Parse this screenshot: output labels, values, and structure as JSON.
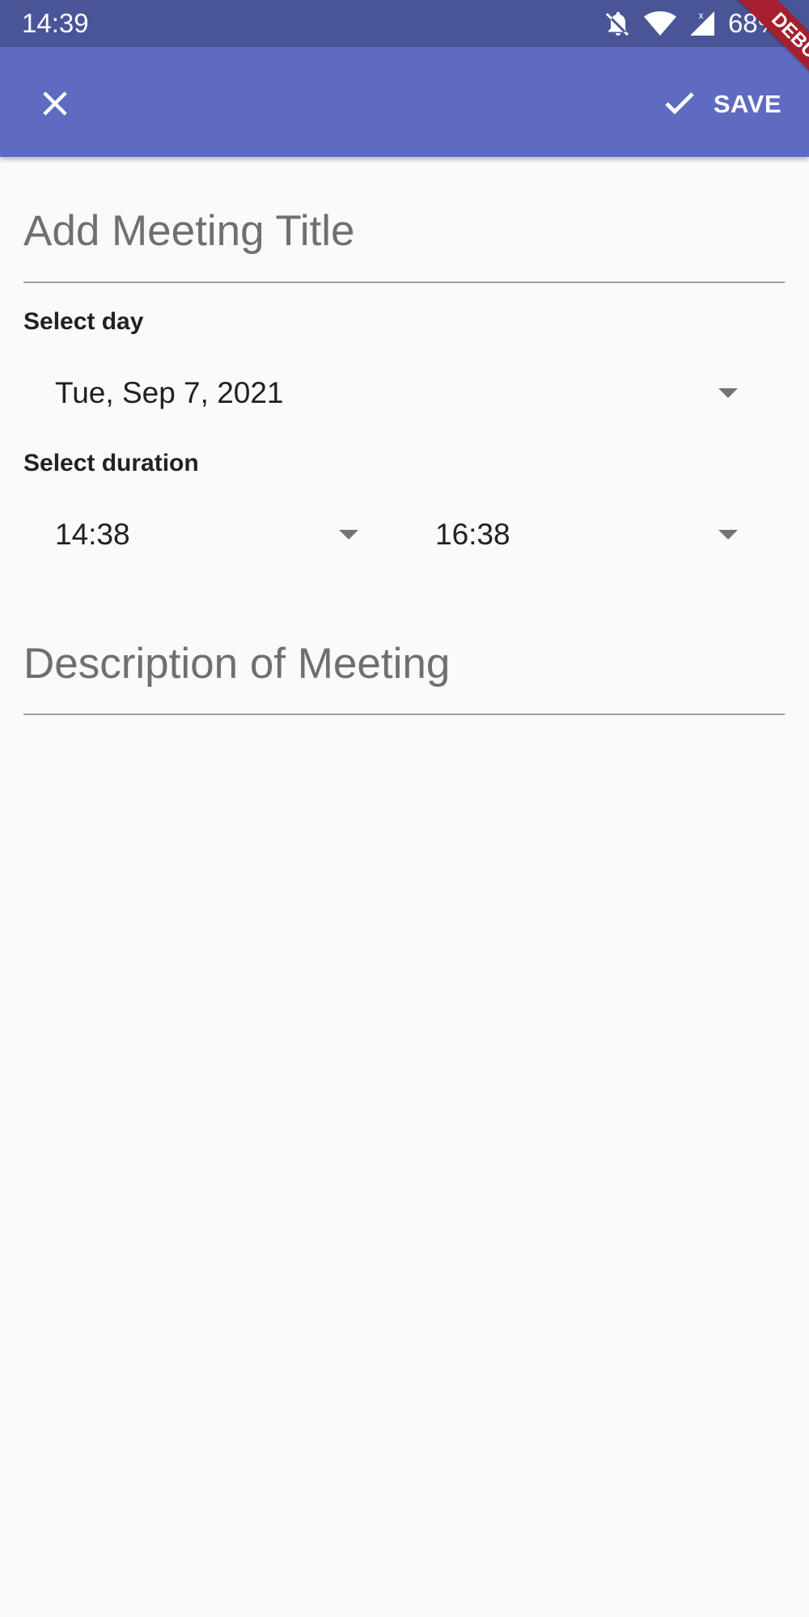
{
  "status_bar": {
    "time": "14:39",
    "battery": "68%"
  },
  "app_bar": {
    "save_label": "SAVE",
    "debug_label": "DEBUG"
  },
  "form": {
    "title_placeholder": "Add Meeting Title",
    "day_label": "Select day",
    "day_value": "Tue, Sep 7, 2021",
    "duration_label": "Select duration",
    "start_time": "14:38",
    "end_time": "16:38",
    "description_placeholder": "Description of Meeting"
  },
  "colors": {
    "status_bar": "#4a5597",
    "app_bar": "#5e6bc0",
    "debug_ribbon": "#a61f2e",
    "background": "#fafafa"
  }
}
